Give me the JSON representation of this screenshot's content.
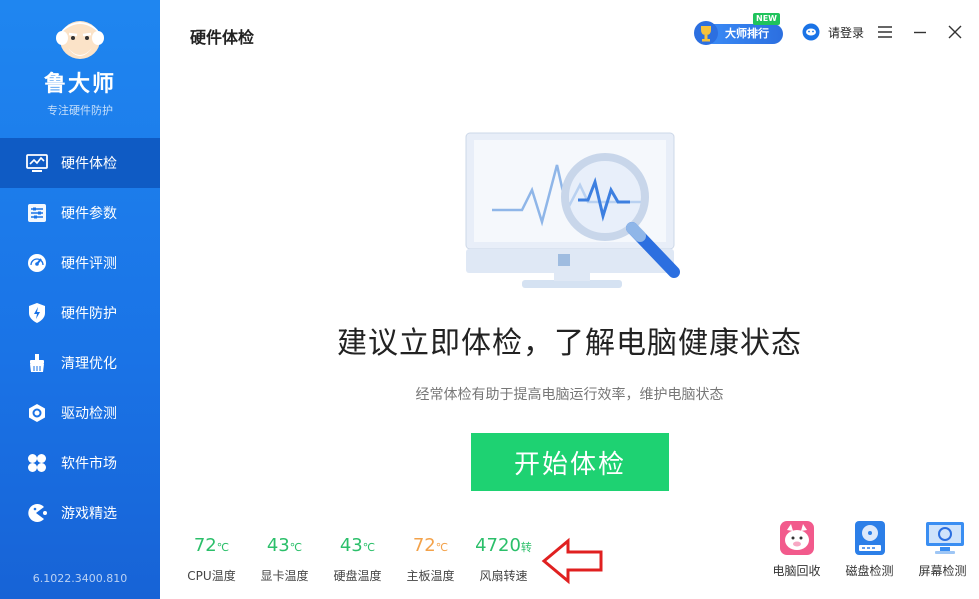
{
  "app": {
    "name": "鲁大师",
    "slogan": "专注硬件防护",
    "version": "6.1022.3400.810"
  },
  "nav": [
    {
      "label": "硬件体检",
      "icon": "monitor-chart-icon",
      "active": true
    },
    {
      "label": "硬件参数",
      "icon": "sliders-icon",
      "active": false
    },
    {
      "label": "硬件评测",
      "icon": "speedometer-icon",
      "active": false
    },
    {
      "label": "硬件防护",
      "icon": "shield-bolt-icon",
      "active": false
    },
    {
      "label": "清理优化",
      "icon": "broom-icon",
      "active": false
    },
    {
      "label": "驱动检测",
      "icon": "gear-hex-icon",
      "active": false
    },
    {
      "label": "软件市场",
      "icon": "clover-icon",
      "active": false
    },
    {
      "label": "游戏精选",
      "icon": "pacman-icon",
      "active": false
    }
  ],
  "header": {
    "title": "硬件体检",
    "rank_label": "大师排行",
    "new_tag": "NEW",
    "login_label": "请登录"
  },
  "main": {
    "headline": "建议立即体检，了解电脑健康状态",
    "subline": "经常体检有助于提高电脑运行效率，维护电脑状态",
    "start_button": "开始体检"
  },
  "stats": [
    {
      "value": "72",
      "unit": "℃",
      "label": "CPU温度",
      "color": "#2bbf6a"
    },
    {
      "value": "43",
      "unit": "℃",
      "label": "显卡温度",
      "color": "#2bbf6a"
    },
    {
      "value": "43",
      "unit": "℃",
      "label": "硬盘温度",
      "color": "#2bbf6a"
    },
    {
      "value": "72",
      "unit": "℃",
      "label": "主板温度",
      "color": "#f3a24a"
    },
    {
      "value": "4720",
      "unit": "转",
      "label": "风扇转速",
      "color": "#2bbf6a"
    }
  ],
  "tools": [
    {
      "label": "电脑回收",
      "icon": "pig-icon"
    },
    {
      "label": "磁盘检测",
      "icon": "disk-icon"
    },
    {
      "label": "屏幕检测",
      "icon": "screen-check-icon"
    }
  ],
  "colors": {
    "sidebar": "#1a73e6",
    "sidebar_active": "#0f5bc4",
    "start_button": "#1ed272",
    "stat_green": "#2bbf6a",
    "stat_orange": "#f3a24a",
    "annotation_arrow": "#e02020"
  }
}
